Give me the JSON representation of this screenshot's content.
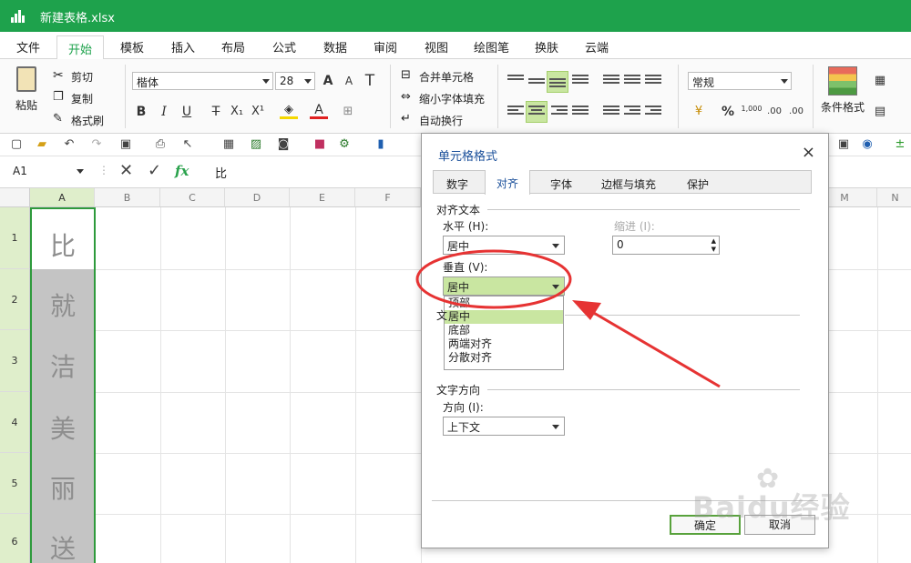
{
  "titlebar": {
    "title": "新建表格.xlsx"
  },
  "menu": {
    "tabs": [
      "文件",
      "开始",
      "模板",
      "插入",
      "布局",
      "公式",
      "数据",
      "审阅",
      "视图",
      "绘图笔",
      "换肤",
      "云端"
    ]
  },
  "ribbon": {
    "paste": "粘贴",
    "cut": "剪切",
    "copy": "复制",
    "format_painter": "格式刷",
    "font_name": "楷体",
    "font_size": "28",
    "bold": "B",
    "italic": "I",
    "underline": "U",
    "strike": "T",
    "subscript": "X₁",
    "superscript": "X¹",
    "merge": "合并单元格",
    "shrink": "缩小字体填充",
    "wrap": "自动换行",
    "number_format": "常规",
    "conditional_format": "条件格式",
    "percent": "%",
    "thousands": "1,000",
    "inc_decimal": ".00",
    "dec_decimal": ".00",
    "font_grow": "A",
    "font_shrink": "A",
    "clear_format": "T",
    "fill_letter": "A"
  },
  "formula": {
    "name_box": "A1",
    "fx": "fx",
    "value": "比"
  },
  "grid": {
    "columns": [
      "A",
      "B",
      "C",
      "D",
      "E",
      "F",
      "M",
      "N"
    ],
    "rows": [
      "1",
      "2",
      "3",
      "4",
      "5",
      "6"
    ],
    "a_cells": [
      "比",
      "就",
      "洁",
      "美",
      "丽",
      "送"
    ]
  },
  "dialog": {
    "title": "单元格格式",
    "close": "×",
    "tabs": [
      "数字",
      "对齐",
      "字体",
      "边框与填充",
      "保护"
    ],
    "align_group": "对齐文本",
    "horizontal_label": "水平 (H):",
    "horizontal_value": "居中",
    "indent_label": "缩进 (I):",
    "indent_value": "0",
    "vertical_label": "垂直 (V):",
    "vertical_value": "居中",
    "vertical_options": [
      "顶部",
      "居中",
      "底部",
      "两端对齐",
      "分散对齐"
    ],
    "text_control_group_fragment": "文",
    "direction_group": "文字方向",
    "direction_label": "方向 (I):",
    "direction_value": "上下文",
    "ok": "确定",
    "cancel": "取消"
  },
  "watermark": {
    "text": "Baidu经验"
  },
  "colors": {
    "title_green": "#1ea24c",
    "accent_green": "#c9e6a1",
    "annotation_red": "#e63333",
    "dialog_title_blue": "#1a4f9a"
  }
}
